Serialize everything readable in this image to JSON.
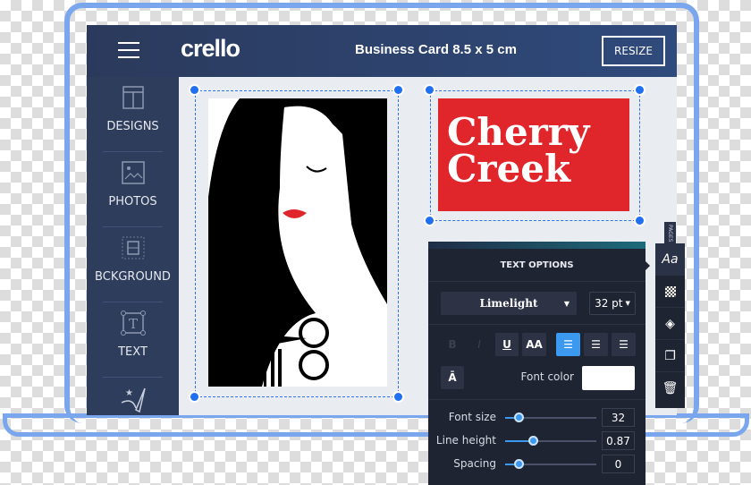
{
  "header": {
    "logo": "crello",
    "title": "Business Card 8.5 x 5 cm",
    "resize_label": "RESIZE"
  },
  "sidebar": {
    "items": [
      {
        "label": "DESIGNS",
        "icon": "layout-icon"
      },
      {
        "label": "PHOTOS",
        "icon": "image-icon"
      },
      {
        "label": "BCKGROUND",
        "icon": "background-icon"
      },
      {
        "label": "TEXT",
        "icon": "text-box-icon"
      },
      {
        "label": "",
        "icon": "brush-icon"
      }
    ]
  },
  "canvas": {
    "card_text_line1": "Cherry",
    "card_text_line2": "Creek",
    "card_color": "#e0252b"
  },
  "pages_tab": "PAGES",
  "text_options": {
    "title": "TEXT OPTIONS",
    "font": "Limelight",
    "size": "32 pt",
    "bold": "B",
    "italic": "I",
    "underline": "U",
    "caps": "AA",
    "shadow": "Ā",
    "font_color_label": "Font color",
    "font_color": "#ffffff",
    "sliders": [
      {
        "label": "Font size",
        "value": "32",
        "level": 0.15
      },
      {
        "label": "Line height",
        "value": "0.87",
        "level": 0.3
      },
      {
        "label": "Spacing",
        "value": "0",
        "level": 0.15
      }
    ]
  },
  "toolbar": [
    {
      "icon": "text-style-icon",
      "label": "Aa"
    },
    {
      "icon": "transparency-icon"
    },
    {
      "icon": "layers-icon"
    },
    {
      "icon": "duplicate-icon"
    },
    {
      "icon": "trash-icon"
    }
  ],
  "colors": {
    "accent": "#3b9af0",
    "frame": "#79a6ec",
    "header": "#2b3a5c"
  }
}
